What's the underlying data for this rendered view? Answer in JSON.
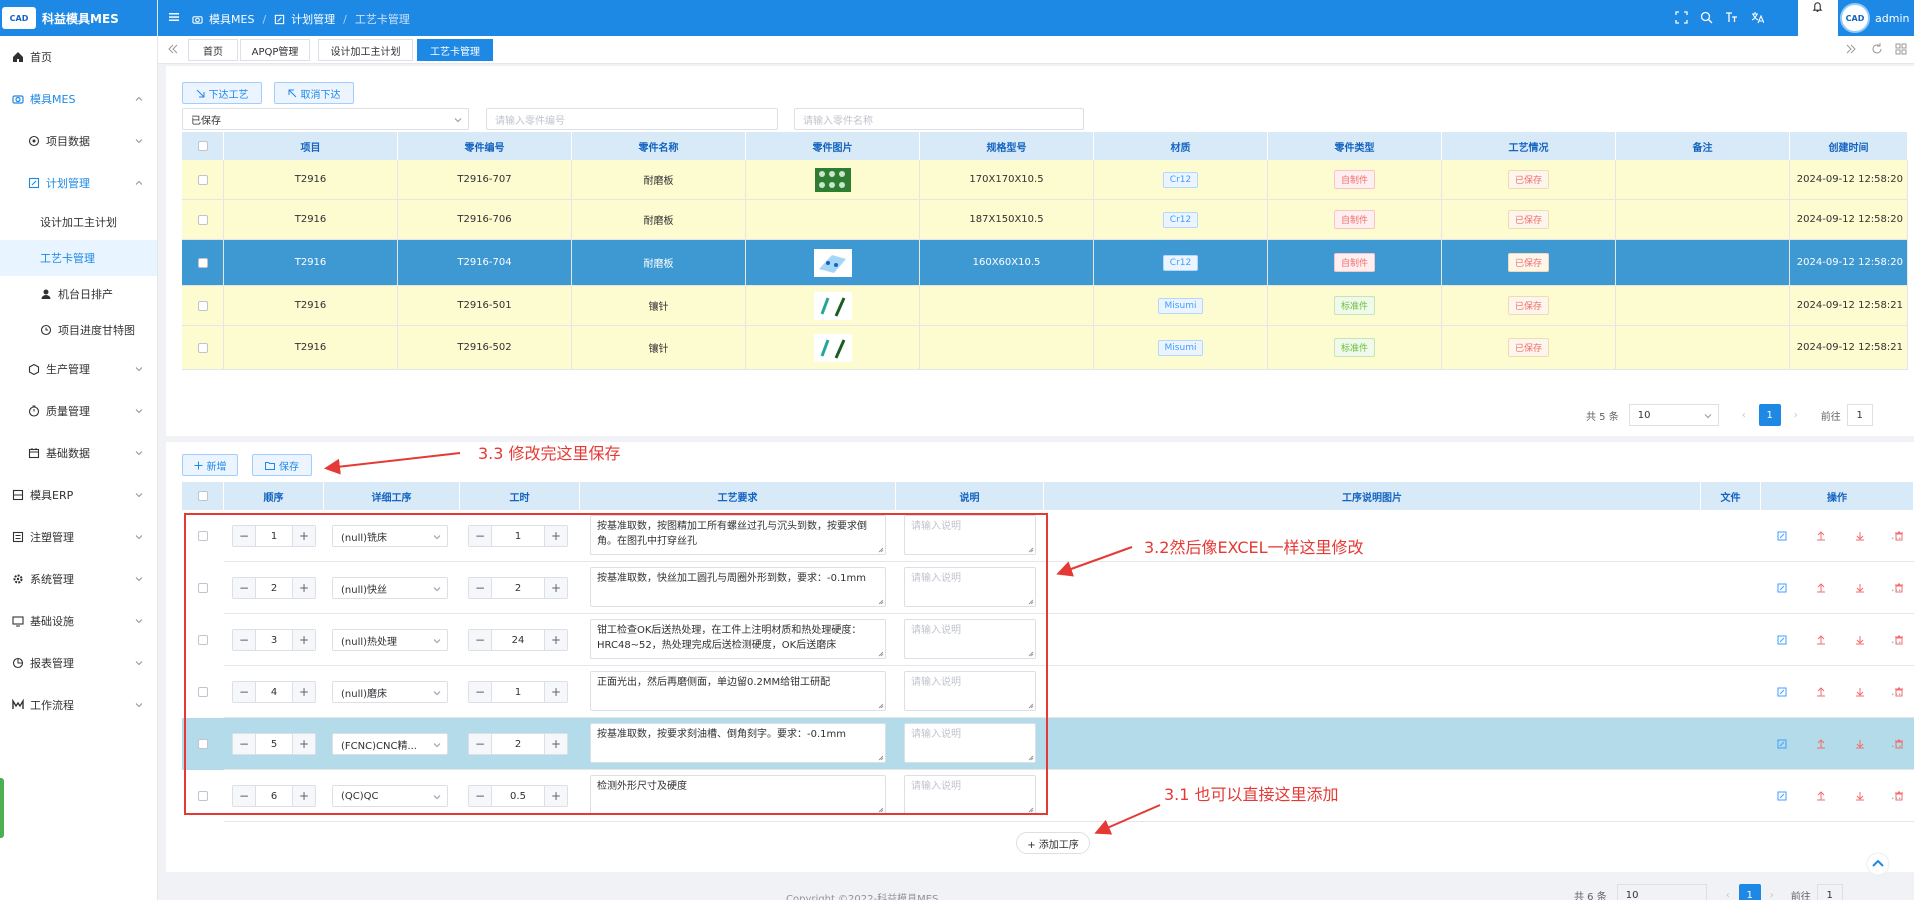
{
  "logo": {
    "badge": "CAD",
    "title": "科益模具MES"
  },
  "sidebar": {
    "items": [
      {
        "label": "首页",
        "icon": "home-icon",
        "level": 0
      },
      {
        "label": "模具MES",
        "icon": "camera-icon",
        "level": 0,
        "state": "open"
      },
      {
        "label": "项目数据",
        "icon": "target-icon",
        "level": 1,
        "state": "closed"
      },
      {
        "label": "计划管理",
        "icon": "edit-icon",
        "level": 1,
        "state": "open"
      },
      {
        "label": "设计加工主计划",
        "level": 2
      },
      {
        "label": "工艺卡管理",
        "level": 2,
        "state": "active"
      },
      {
        "label": "机台日排产",
        "icon": "user-icon",
        "level": 2
      },
      {
        "label": "项目进度甘特图",
        "icon": "clock-icon",
        "level": 2
      },
      {
        "label": "生产管理",
        "icon": "box-icon",
        "level": 1,
        "state": "closed"
      },
      {
        "label": "质量管理",
        "icon": "timer-icon",
        "level": 1,
        "state": "closed"
      },
      {
        "label": "基础数据",
        "icon": "calendar-icon",
        "level": 1,
        "state": "closed"
      },
      {
        "label": "模具ERP",
        "icon": "layers-icon",
        "level": 0,
        "state": "closed"
      },
      {
        "label": "注塑管理",
        "icon": "list-icon",
        "level": 0,
        "state": "closed"
      },
      {
        "label": "系统管理",
        "icon": "gear-icon",
        "level": 0,
        "state": "closed"
      },
      {
        "label": "基础设施",
        "icon": "monitor-icon",
        "level": 0,
        "state": "closed"
      },
      {
        "label": "报表管理",
        "icon": "chart-icon",
        "level": 0,
        "state": "closed"
      },
      {
        "label": "工作流程",
        "icon": "flow-icon",
        "level": 0,
        "state": "closed"
      }
    ]
  },
  "header": {
    "breadcrumb": [
      "模具MES",
      "计划管理",
      "工艺卡管理"
    ],
    "user": "admin",
    "avatar_text": "CAD"
  },
  "tabs": [
    "首页",
    "APQP管理",
    "设计加工主计划",
    "工艺卡管理"
  ],
  "toolbar": {
    "release": "下达工艺",
    "cancel_release": "取消下达"
  },
  "filters": {
    "status": "已保存",
    "part_no_placeholder": "请输入零件编号",
    "part_name_placeholder": "请输入零件名称"
  },
  "parts": {
    "columns": [
      "项目",
      "零件编号",
      "零件名称",
      "零件图片",
      "规格型号",
      "材质",
      "零件类型",
      "工艺情况",
      "备注",
      "创建时间"
    ],
    "rows": [
      {
        "project": "T2916",
        "part_no": "T2916-707",
        "name": "耐磨板",
        "image": "wear-plate-image",
        "spec": "170X170X10.5",
        "material": "Cr12",
        "type": "自制件",
        "status": "已保存",
        "remark": "",
        "created": "2024-09-12 12:58:20",
        "selected": false
      },
      {
        "project": "T2916",
        "part_no": "T2916-706",
        "name": "耐磨板",
        "image": "",
        "spec": "187X150X10.5",
        "material": "Cr12",
        "type": "自制件",
        "status": "已保存",
        "remark": "",
        "created": "2024-09-12 12:58:20",
        "selected": false
      },
      {
        "project": "T2916",
        "part_no": "T2916-704",
        "name": "耐磨板",
        "image": "plate-image",
        "spec": "160X60X10.5",
        "material": "Cr12",
        "type": "自制件",
        "status": "已保存",
        "remark": "",
        "created": "2024-09-12 12:58:20",
        "selected": true
      },
      {
        "project": "T2916",
        "part_no": "T2916-501",
        "name": "镶针",
        "image": "pin-image",
        "spec": "",
        "material": "Misumi",
        "type": "标准件",
        "status": "已保存",
        "remark": "",
        "created": "2024-09-12 12:58:21",
        "selected": false
      },
      {
        "project": "T2916",
        "part_no": "T2916-502",
        "name": "镶针",
        "image": "pin-image",
        "spec": "",
        "material": "Misumi",
        "type": "标准件",
        "status": "已保存",
        "remark": "",
        "created": "2024-09-12 12:58:21",
        "selected": false
      }
    ],
    "pagination": {
      "total": "共 5 条",
      "page_size": "10",
      "page": "1",
      "goto": "前往",
      "goto_value": "1"
    }
  },
  "process": {
    "add": "新增",
    "save": "保存",
    "columns": [
      "顺序",
      "详细工序",
      "工时",
      "工艺要求",
      "说明",
      "工序说明图片",
      "文件",
      "操作"
    ],
    "note_placeholder": "请输入说明",
    "rows": [
      {
        "seq": "1",
        "step": "(null)铣床",
        "hours": "1",
        "req": "按基准取数，按图精加工所有螺丝过孔与沉头到数，按要求倒角。在图孔中打穿丝孔",
        "selected": false
      },
      {
        "seq": "2",
        "step": "(null)快丝",
        "hours": "2",
        "req": "按基准取数，快丝加工圆孔与周圈外形到数，要求：-0.1mm",
        "selected": false
      },
      {
        "seq": "3",
        "step": "(null)热处理",
        "hours": "24",
        "req": "钳工检查OK后送热处理，在工件上注明材质和热处理硬度：HRC48~52，热处理完成后送检测硬度，OK后送磨床",
        "selected": false
      },
      {
        "seq": "4",
        "step": "(null)磨床",
        "hours": "1",
        "req": "正面光出，然后再磨侧面，单边留0.2MM给钳工研配",
        "selected": false
      },
      {
        "seq": "5",
        "step": "(FCNC)CNC精...",
        "hours": "2",
        "req": "按基准取数，按要求刻油槽、倒角刻字。要求：-0.1mm",
        "selected": true
      },
      {
        "seq": "6",
        "step": "(QC)QC",
        "hours": "0.5",
        "req": "检测外形尺寸及硬度",
        "selected": false
      }
    ],
    "add_step": "+ 添加工序",
    "pagination": {
      "total": "共 6 条",
      "page_size": "10",
      "page": "1",
      "goto": "前往",
      "goto_value": "1"
    }
  },
  "annotations": {
    "a1": "3.3 修改完这里保存",
    "a2": "3.2然后像EXCEL一样这里修改",
    "a3": "3.1 也可以直接这里添加"
  },
  "footer": "Copyright ©2022-科益模具MES"
}
